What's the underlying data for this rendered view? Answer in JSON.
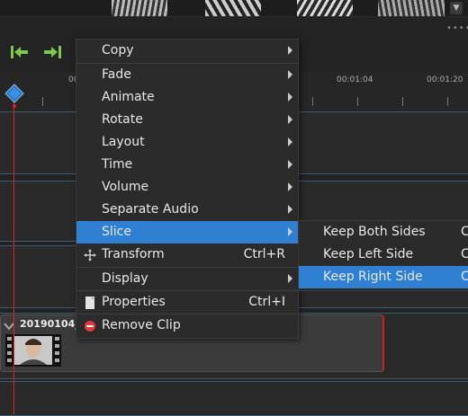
{
  "toolbar": {
    "jump_start_icon": "jump-to-start-icon",
    "jump_end_icon": "jump-to-end-icon",
    "accent_color": "#7ec850"
  },
  "ruler": {
    "labels": [
      "00",
      "00:01:04",
      "00:01:20"
    ]
  },
  "clip": {
    "title": "20190104_"
  },
  "context_menu": {
    "items": [
      {
        "label": "Copy",
        "shortcut": "",
        "submenu": true
      },
      {
        "label": "Fade",
        "shortcut": "",
        "submenu": true
      },
      {
        "label": "Animate",
        "shortcut": "",
        "submenu": true
      },
      {
        "label": "Rotate",
        "shortcut": "",
        "submenu": true
      },
      {
        "label": "Layout",
        "shortcut": "",
        "submenu": true
      },
      {
        "label": "Time",
        "shortcut": "",
        "submenu": true
      },
      {
        "label": "Volume",
        "shortcut": "",
        "submenu": true
      },
      {
        "label": "Separate Audio",
        "shortcut": "",
        "submenu": true
      },
      {
        "label": "Slice",
        "shortcut": "",
        "submenu": true,
        "selected": true
      },
      {
        "label": "Transform",
        "shortcut": "Ctrl+R",
        "icon": "move-icon"
      },
      {
        "label": "Display",
        "shortcut": "",
        "submenu": true
      },
      {
        "label": "Properties",
        "shortcut": "Ctrl+I",
        "icon": "document-icon"
      },
      {
        "label": "Remove Clip",
        "shortcut": "",
        "icon": "remove-icon"
      }
    ]
  },
  "slice_submenu": {
    "items": [
      {
        "label": "Keep Both Sides",
        "shortcut": "C"
      },
      {
        "label": "Keep Left Side",
        "shortcut": "C"
      },
      {
        "label": "Keep Right Side",
        "shortcut": "C",
        "selected": true
      }
    ]
  },
  "colors": {
    "selection": "#2f7fd3",
    "playhead": "#d22222",
    "track_border": "#3c5c72"
  }
}
